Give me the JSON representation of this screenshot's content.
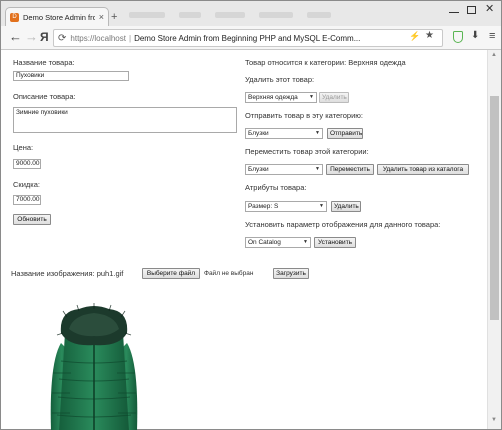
{
  "browser": {
    "tab_title": "Demo Store Admin fro",
    "url_host": "https://localhost",
    "url_page_title": "Demo Store Admin from Beginning PHP and MySQL E-Comm...",
    "nav_icon": "Я"
  },
  "product_form": {
    "name_label": "Название товара:",
    "name_value": "Пуховики",
    "description_label": "Описание товара:",
    "description_value": "Зимние пуховики",
    "price_label": "Цена:",
    "price_value": "9000.00",
    "discount_label": "Скидка:",
    "discount_value": "7000.00",
    "update_button": "Обновить"
  },
  "category_panel": {
    "belongs_text": "Товар относится к категории: Верхняя одежда",
    "remove_label": "Удалить этот товар:",
    "remove_select": "Верхняя одежда",
    "remove_button": "Удалить",
    "assign_label": "Отправить товар в эту категорию:",
    "assign_select": "Блузки",
    "assign_button": "Отправить",
    "move_label": "Переместить товар этой категории:",
    "move_select": "Блузки",
    "move_button": "Переместить",
    "remove_from_catalog_button": "Удалить товар из каталога",
    "attributes_label": "Атрибуты товара:",
    "attributes_select": "Размер: S",
    "attributes_button": "Удалить",
    "display_label": "Установить параметр отображения для данного товара:",
    "display_select": "On Catalog",
    "display_button": "Установить"
  },
  "image_upload": {
    "label": "Название изображения: puh1.gif",
    "choose_button": "Выберите файл",
    "no_file_text": "Файл не выбран",
    "upload_button": "Загрузить"
  },
  "colors": {
    "jacket_green": "#1f7a4f",
    "fur_dark": "#1a3a2a",
    "scroll_thumb": "#c1c1c1"
  }
}
